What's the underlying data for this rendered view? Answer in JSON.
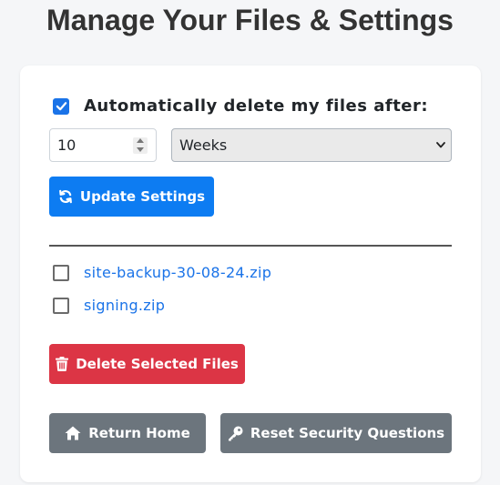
{
  "page": {
    "title": "Manage Your Files & Settings"
  },
  "settings": {
    "auto_delete_checked": true,
    "auto_delete_label": "Automatically delete my files after:",
    "number_value": "10",
    "unit_selected": "Weeks",
    "update_button_label": "Update Settings"
  },
  "files": [
    {
      "name": "site-backup-30-08-24.zip",
      "checked": false
    },
    {
      "name": "signing.zip",
      "checked": false
    }
  ],
  "actions": {
    "delete_label": "Delete Selected Files",
    "home_label": "Return Home",
    "security_label": "Reset Security Questions"
  },
  "colors": {
    "primary": "#0d7cf2",
    "danger": "#dc3545",
    "secondary": "#6c757d",
    "link": "#1a73e8"
  },
  "icons": {
    "update": "refresh-icon",
    "delete": "trash-icon",
    "home": "home-icon",
    "security": "key-icon"
  }
}
